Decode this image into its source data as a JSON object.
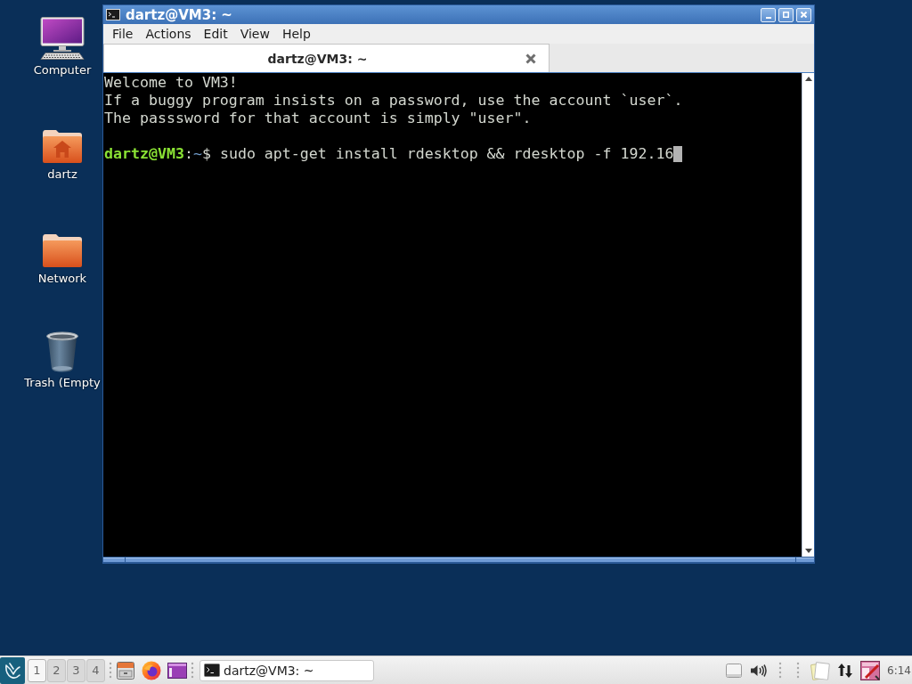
{
  "desktop_icons": [
    {
      "kind": "computer",
      "label": "Computer"
    },
    {
      "kind": "home_folder",
      "label": "dartz"
    },
    {
      "kind": "folder",
      "label": "Network"
    },
    {
      "kind": "trash",
      "label": "Trash (Empty"
    }
  ],
  "window": {
    "title": "dartz@VM3: ~",
    "menu": [
      "File",
      "Actions",
      "Edit",
      "View",
      "Help"
    ],
    "tabs": [
      {
        "label": "dartz@VM3: ~",
        "selected": true
      }
    ],
    "terminal": {
      "lines": [
        {
          "kind": "output",
          "text": "Welcome to VM3!"
        },
        {
          "kind": "output",
          "text": "If a buggy program insists on a password, use the account `user`."
        },
        {
          "kind": "output",
          "text": "The passsword for that account is simply \"user\"."
        },
        {
          "kind": "blank"
        },
        {
          "kind": "prompt",
          "user_host": "dartz@VM3",
          "separator": ":",
          "path": "~",
          "symbol": "$",
          "command": "sudo apt-get install rdesktop && rdesktop -f 192.16",
          "cursor": true
        }
      ]
    }
  },
  "taskbar": {
    "workspaces": [
      {
        "label": "1",
        "selected": true
      },
      {
        "label": "2",
        "selected": false
      },
      {
        "label": "3",
        "selected": false
      },
      {
        "label": "4",
        "selected": false
      }
    ],
    "tasks": [
      {
        "label": "dartz@VM3: ~"
      }
    ],
    "clock": "6:14"
  }
}
